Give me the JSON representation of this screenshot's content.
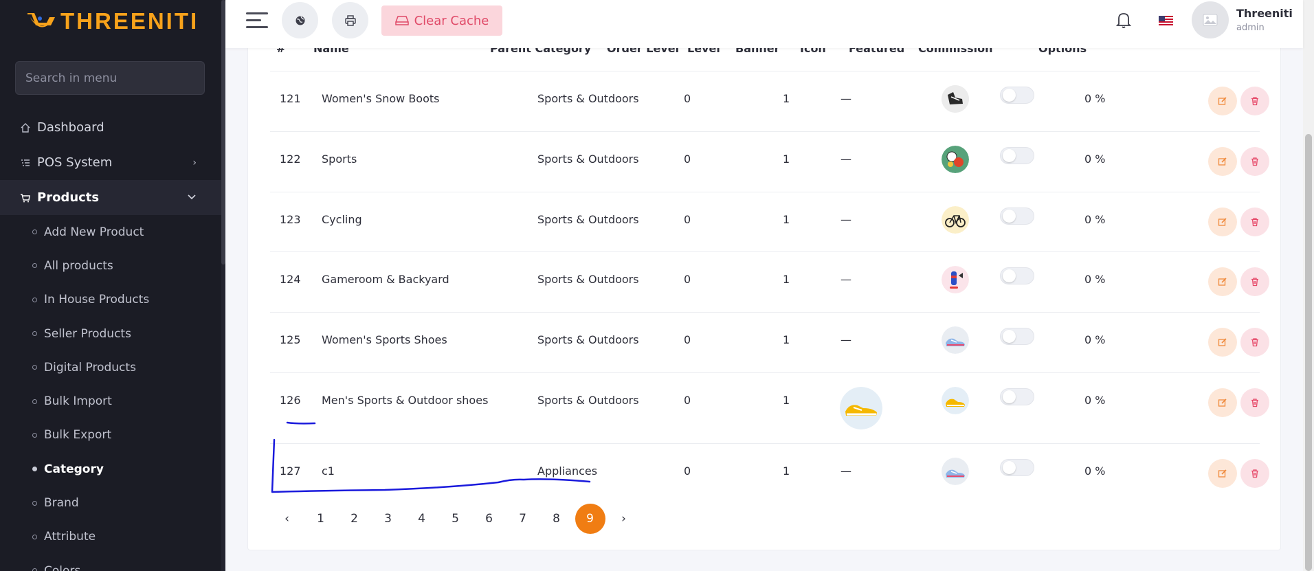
{
  "brand": {
    "logo_text": "THREENITI"
  },
  "sidebar": {
    "search_placeholder": "Search in menu",
    "menu": [
      {
        "label": "Dashboard"
      },
      {
        "label": "POS System"
      },
      {
        "label": "Products"
      }
    ],
    "submenu": [
      {
        "label": "Add New Product"
      },
      {
        "label": "All products"
      },
      {
        "label": "In House Products"
      },
      {
        "label": "Seller Products"
      },
      {
        "label": "Digital Products"
      },
      {
        "label": "Bulk Import"
      },
      {
        "label": "Bulk Export"
      },
      {
        "label": "Category"
      },
      {
        "label": "Brand"
      },
      {
        "label": "Attribute"
      },
      {
        "label": "Colors"
      }
    ]
  },
  "topbar": {
    "clear_cache": "Clear Cache",
    "user_name": "Threeniti",
    "user_role": "admin"
  },
  "table": {
    "headers": [
      "#",
      "Name",
      "Parent Category",
      "Order Level",
      "Level",
      "Banner",
      "Icon",
      "Featured",
      "Commission",
      "Options"
    ],
    "rows": [
      {
        "id": "121",
        "name": "Women's Snow Boots",
        "parent": "Sports & Outdoors",
        "order_level": "0",
        "level": "1",
        "banner": "—",
        "commission": "0 %",
        "icon": "snow-boot-icon",
        "featured": false
      },
      {
        "id": "122",
        "name": "Sports",
        "parent": "Sports & Outdoors",
        "order_level": "0",
        "level": "1",
        "banner": "—",
        "commission": "0 %",
        "icon": "sports-balls-icon",
        "featured": false
      },
      {
        "id": "123",
        "name": "Cycling",
        "parent": "Sports & Outdoors",
        "order_level": "0",
        "level": "1",
        "banner": "—",
        "commission": "0 %",
        "icon": "bicycle-icon",
        "featured": false
      },
      {
        "id": "124",
        "name": "Gameroom & Backyard",
        "parent": "Sports & Outdoors",
        "order_level": "0",
        "level": "1",
        "banner": "—",
        "commission": "0 %",
        "icon": "punching-bag-icon",
        "featured": false
      },
      {
        "id": "125",
        "name": "Women's Sports Shoes",
        "parent": "Sports & Outdoors",
        "order_level": "0",
        "level": "1",
        "banner": "—",
        "commission": "0 %",
        "icon": "sneaker-blue-icon",
        "featured": false
      },
      {
        "id": "126",
        "name": "Men's Sports & Outdoor shoes",
        "parent": "Sports & Outdoors",
        "order_level": "0",
        "level": "1",
        "banner": "",
        "commission": "0 %",
        "icon": "sneaker-yellow-icon",
        "featured": false
      },
      {
        "id": "127",
        "name": "c1",
        "parent": "Appliances",
        "order_level": "0",
        "level": "1",
        "banner": "—",
        "commission": "0 %",
        "icon": "sneaker-blue-icon",
        "featured": false
      }
    ]
  },
  "pagination": {
    "prev": "‹",
    "pages": [
      "1",
      "2",
      "3",
      "4",
      "5",
      "6",
      "7",
      "8",
      "9"
    ],
    "current": "9",
    "next": "›"
  },
  "colors": {
    "sidebar_bg": "#1b1c25",
    "accent": "#f07d13",
    "logo": "#f7a21b",
    "clear_cache_bg": "#fbd6dc",
    "clear_cache_text": "#e04a68",
    "annotation": "#1a1adc"
  }
}
